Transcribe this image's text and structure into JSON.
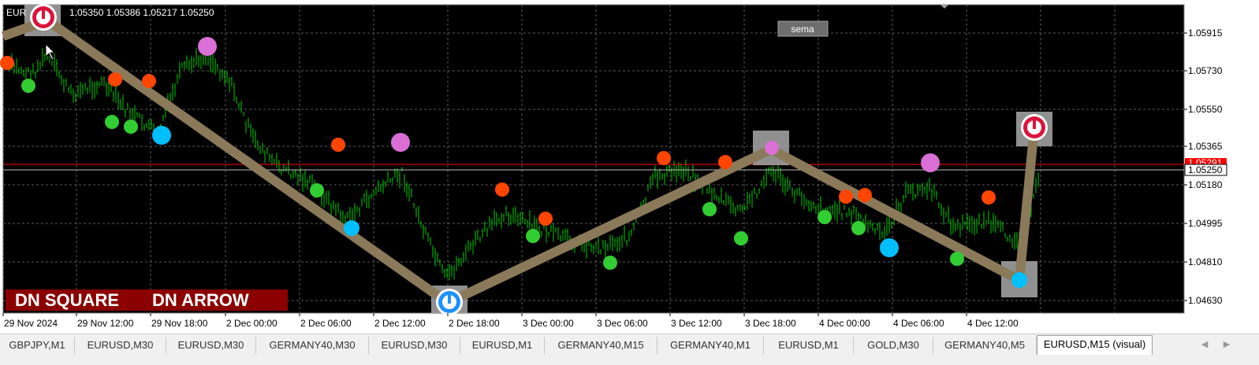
{
  "header": {
    "symbol": "EUR",
    "ohlc": "1.05350 1.05386 1.05217 1.05250"
  },
  "sema_button": {
    "label": "sema"
  },
  "banner": {
    "left": "DN SQUARE",
    "right": "DN ARROW",
    "color": "#8b0000"
  },
  "price_axis": {
    "labels": [
      "1.05915",
      "1.05730",
      "1.05550",
      "1.05365",
      "1.05180",
      "1.04995",
      "1.04810",
      "1.04630"
    ],
    "current_price": "1.05250",
    "red_level": "1.05291"
  },
  "time_axis": {
    "labels": [
      "29 Nov 2024",
      "29 Nov 12:00",
      "29 Nov 18:00",
      "2 Dec 00:00",
      "2 Dec 06:00",
      "2 Dec 12:00",
      "2 Dec 18:00",
      "3 Dec 00:00",
      "3 Dec 06:00",
      "3 Dec 12:00",
      "3 Dec 18:00",
      "4 Dec 00:00",
      "4 Dec 06:00",
      "4 Dec 12:00"
    ]
  },
  "colors": {
    "background": "#000000",
    "candles": "#00c800",
    "grid": "#5a5a5a",
    "zigzag": "#8b7a5a",
    "dot_orange": "#ff4500",
    "dot_green": "#32cd32",
    "dot_violet": "#da70d6",
    "dot_blue": "#00bfff",
    "current_line": "#c0c0c0",
    "red_line": "#ff0000"
  },
  "tabs": [
    {
      "label": "GBPJPY,M1",
      "active": false
    },
    {
      "label": "EURUSD,M30",
      "active": false
    },
    {
      "label": "EURUSD,M30",
      "active": false
    },
    {
      "label": "GERMANY40,M30",
      "active": false
    },
    {
      "label": "EURUSD,M30",
      "active": false
    },
    {
      "label": "EURUSD,M1",
      "active": false
    },
    {
      "label": "GERMANY40,M15",
      "active": false
    },
    {
      "label": "GERMANY40,M1",
      "active": false
    },
    {
      "label": "EURUSD,M1",
      "active": false
    },
    {
      "label": "GOLD,M30",
      "active": false
    },
    {
      "label": "GERMANY40,M5",
      "active": false
    },
    {
      "label": "EURUSD,M15 (visual)",
      "active": true
    }
  ],
  "icons": {
    "tab_scroll_left": "chevron-left-icon",
    "tab_scroll_right": "chevron-right-icon",
    "cursor": "mouse-pointer-icon",
    "down_signal": "down-arrow-signal-icon",
    "up_signal": "up-arrow-signal-icon"
  }
}
